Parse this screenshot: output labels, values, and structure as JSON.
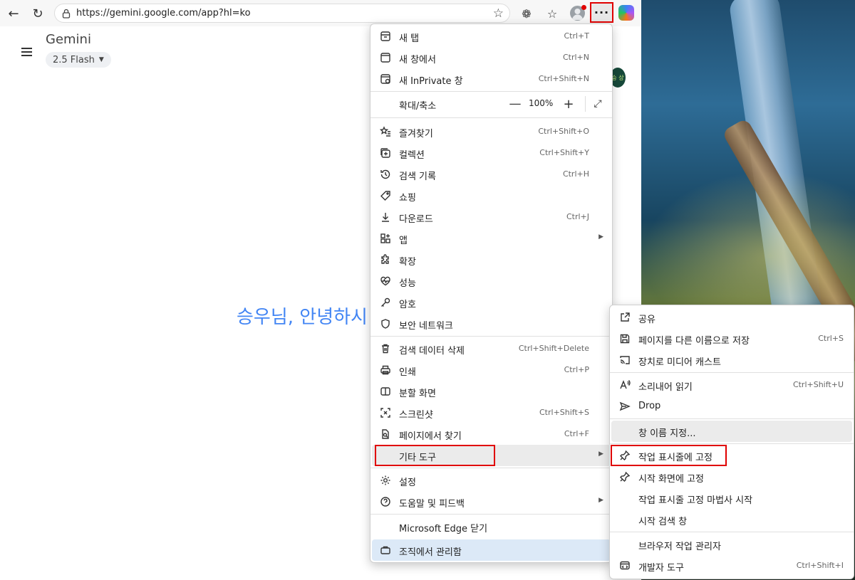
{
  "browser": {
    "url": "https://gemini.google.com/app?hl=ko",
    "more_label": "···"
  },
  "page": {
    "app_title": "Gemini",
    "model": "2.5 Flash",
    "greeting": "승우님, 안녕하시",
    "avatar_text": "승 상"
  },
  "main_menu": {
    "zoom_label": "확대/축소",
    "zoom_value": "100%",
    "items": [
      {
        "icon": "new-tab-icon",
        "label": "새 탭",
        "shortcut": "Ctrl+T"
      },
      {
        "icon": "new-window-icon",
        "label": "새 창에서",
        "shortcut": "Ctrl+N"
      },
      {
        "icon": "inprivate-icon",
        "label": "새 InPrivate 창",
        "shortcut": "Ctrl+Shift+N"
      },
      {
        "icon": "favorites-icon",
        "label": "즐겨찾기",
        "shortcut": "Ctrl+Shift+O"
      },
      {
        "icon": "collections-icon",
        "label": "컬렉션",
        "shortcut": "Ctrl+Shift+Y"
      },
      {
        "icon": "history-icon",
        "label": "검색 기록",
        "shortcut": "Ctrl+H"
      },
      {
        "icon": "shopping-tag-icon",
        "label": "쇼핑",
        "shortcut": ""
      },
      {
        "icon": "download-icon",
        "label": "다운로드",
        "shortcut": "Ctrl+J"
      },
      {
        "icon": "apps-icon",
        "label": "앱",
        "shortcut": ""
      },
      {
        "icon": "extensions-icon",
        "label": "확장",
        "shortcut": ""
      },
      {
        "icon": "performance-icon",
        "label": "성능",
        "shortcut": ""
      },
      {
        "icon": "key-icon",
        "label": "암호",
        "shortcut": ""
      },
      {
        "icon": "shield-icon",
        "label": "보안 네트워크",
        "shortcut": ""
      },
      {
        "icon": "trash-icon",
        "label": "검색 데이터 삭제",
        "shortcut": "Ctrl+Shift+Delete"
      },
      {
        "icon": "print-icon",
        "label": "인쇄",
        "shortcut": "Ctrl+P"
      },
      {
        "icon": "split-screen-icon",
        "label": "분할 화면",
        "shortcut": ""
      },
      {
        "icon": "screenshot-icon",
        "label": "스크린샷",
        "shortcut": "Ctrl+Shift+S"
      },
      {
        "icon": "find-in-page-icon",
        "label": "페이지에서 찾기",
        "shortcut": "Ctrl+F"
      },
      {
        "icon": "",
        "label": "기타 도구",
        "shortcut": ""
      },
      {
        "icon": "gear-icon",
        "label": "설정",
        "shortcut": ""
      },
      {
        "icon": "help-icon",
        "label": "도움말 및 피드백",
        "shortcut": ""
      },
      {
        "icon": "",
        "label": "Microsoft Edge 닫기",
        "shortcut": ""
      },
      {
        "icon": "briefcase-icon",
        "label": "조직에서 관리함",
        "shortcut": ""
      }
    ]
  },
  "sub_menu": {
    "items": [
      {
        "icon": "share-icon",
        "label": "공유",
        "shortcut": ""
      },
      {
        "icon": "save-icon",
        "label": "페이지를 다른 이름으로 저장",
        "shortcut": "Ctrl+S"
      },
      {
        "icon": "cast-icon",
        "label": "장치로 미디어 캐스트",
        "shortcut": ""
      },
      {
        "icon": "read-aloud-icon",
        "label": "소리내어 읽기",
        "shortcut": "Ctrl+Shift+U"
      },
      {
        "icon": "drop-icon",
        "label": "Drop",
        "shortcut": ""
      },
      {
        "icon": "",
        "label": "창 이름 지정...",
        "shortcut": ""
      },
      {
        "icon": "pin-icon",
        "label": "작업 표시줄에 고정",
        "shortcut": ""
      },
      {
        "icon": "pin-icon",
        "label": "시작 화면에 고정",
        "shortcut": ""
      },
      {
        "icon": "",
        "label": "작업 표시줄 고정 마법사 시작",
        "shortcut": ""
      },
      {
        "icon": "",
        "label": "시작 검색 창",
        "shortcut": ""
      },
      {
        "icon": "",
        "label": "브라우저 작업 관리자",
        "shortcut": ""
      },
      {
        "icon": "dev-tools-icon",
        "label": "개발자 도구",
        "shortcut": "Ctrl+Shift+I"
      }
    ]
  }
}
